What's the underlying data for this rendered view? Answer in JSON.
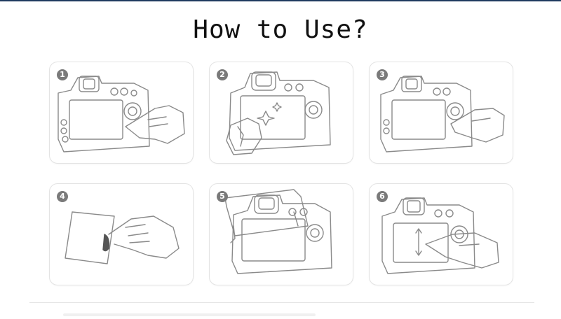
{
  "title": "How to Use?",
  "steps": [
    {
      "number": "1",
      "illustration": "camera-screen-protector-peel-icon"
    },
    {
      "number": "2",
      "illustration": "camera-screen-clean-icon"
    },
    {
      "number": "3",
      "illustration": "camera-screen-dust-remove-icon"
    },
    {
      "number": "4",
      "illustration": "protector-film-peel-icon"
    },
    {
      "number": "5",
      "illustration": "camera-screen-apply-protector-icon"
    },
    {
      "number": "6",
      "illustration": "camera-screen-smooth-protector-icon"
    }
  ],
  "colors": {
    "line": "#8a8a8a",
    "badge": "#7a7a7a",
    "topbar": "#1f3a5f"
  }
}
